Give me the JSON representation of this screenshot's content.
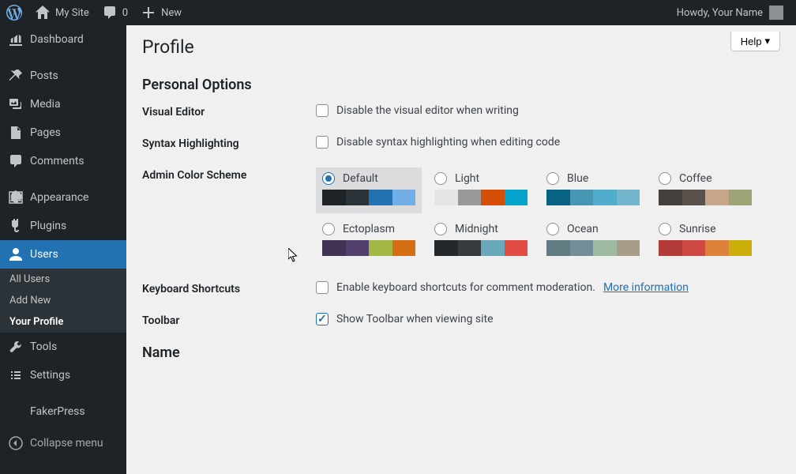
{
  "adminbar": {
    "site_name": "My Site",
    "comments_count": "0",
    "new_label": "New",
    "howdy": "Howdy, Your Name"
  },
  "sidebar": {
    "items": [
      {
        "label": "Dashboard"
      },
      {
        "label": "Posts"
      },
      {
        "label": "Media"
      },
      {
        "label": "Pages"
      },
      {
        "label": "Comments"
      },
      {
        "label": "Appearance"
      },
      {
        "label": "Plugins"
      },
      {
        "label": "Users"
      },
      {
        "label": "Tools"
      },
      {
        "label": "Settings"
      },
      {
        "label": "FakerPress"
      }
    ],
    "users_submenu": [
      {
        "label": "All Users"
      },
      {
        "label": "Add New"
      },
      {
        "label": "Your Profile"
      }
    ],
    "collapse": "Collapse menu"
  },
  "help_label": "Help",
  "page_title": "Profile",
  "section_personal": "Personal Options",
  "rows": {
    "visual_editor": {
      "label": "Visual Editor",
      "desc": "Disable the visual editor when writing"
    },
    "syntax": {
      "label": "Syntax Highlighting",
      "desc": "Disable syntax highlighting when editing code"
    },
    "scheme": {
      "label": "Admin Color Scheme"
    },
    "shortcuts": {
      "label": "Keyboard Shortcuts",
      "desc": "Enable keyboard shortcuts for comment moderation.",
      "link": "More information"
    },
    "toolbar": {
      "label": "Toolbar",
      "desc": "Show Toolbar when viewing site"
    }
  },
  "schemes": [
    {
      "name": "Default",
      "colors": [
        "#1d2327",
        "#2c3338",
        "#2271b1",
        "#72aee6"
      ],
      "selected": true
    },
    {
      "name": "Light",
      "colors": [
        "#e5e5e5",
        "#999999",
        "#d64e07",
        "#04a4cc"
      ],
      "selected": false
    },
    {
      "name": "Blue",
      "colors": [
        "#096484",
        "#4796b3",
        "#52accc",
        "#74b6ce"
      ],
      "selected": false
    },
    {
      "name": "Coffee",
      "colors": [
        "#46403c",
        "#59524c",
        "#c7a589",
        "#9ea476"
      ],
      "selected": false
    },
    {
      "name": "Ectoplasm",
      "colors": [
        "#413256",
        "#523f6d",
        "#a3b745",
        "#d46f15"
      ],
      "selected": false
    },
    {
      "name": "Midnight",
      "colors": [
        "#25282b",
        "#363b3f",
        "#69a8bb",
        "#e14d43"
      ],
      "selected": false
    },
    {
      "name": "Ocean",
      "colors": [
        "#627c83",
        "#738e96",
        "#9ebaa0",
        "#aa9d88"
      ],
      "selected": false
    },
    {
      "name": "Sunrise",
      "colors": [
        "#b43c38",
        "#cf4944",
        "#dd823b",
        "#ccaf0b"
      ],
      "selected": false
    }
  ],
  "section_name": "Name"
}
